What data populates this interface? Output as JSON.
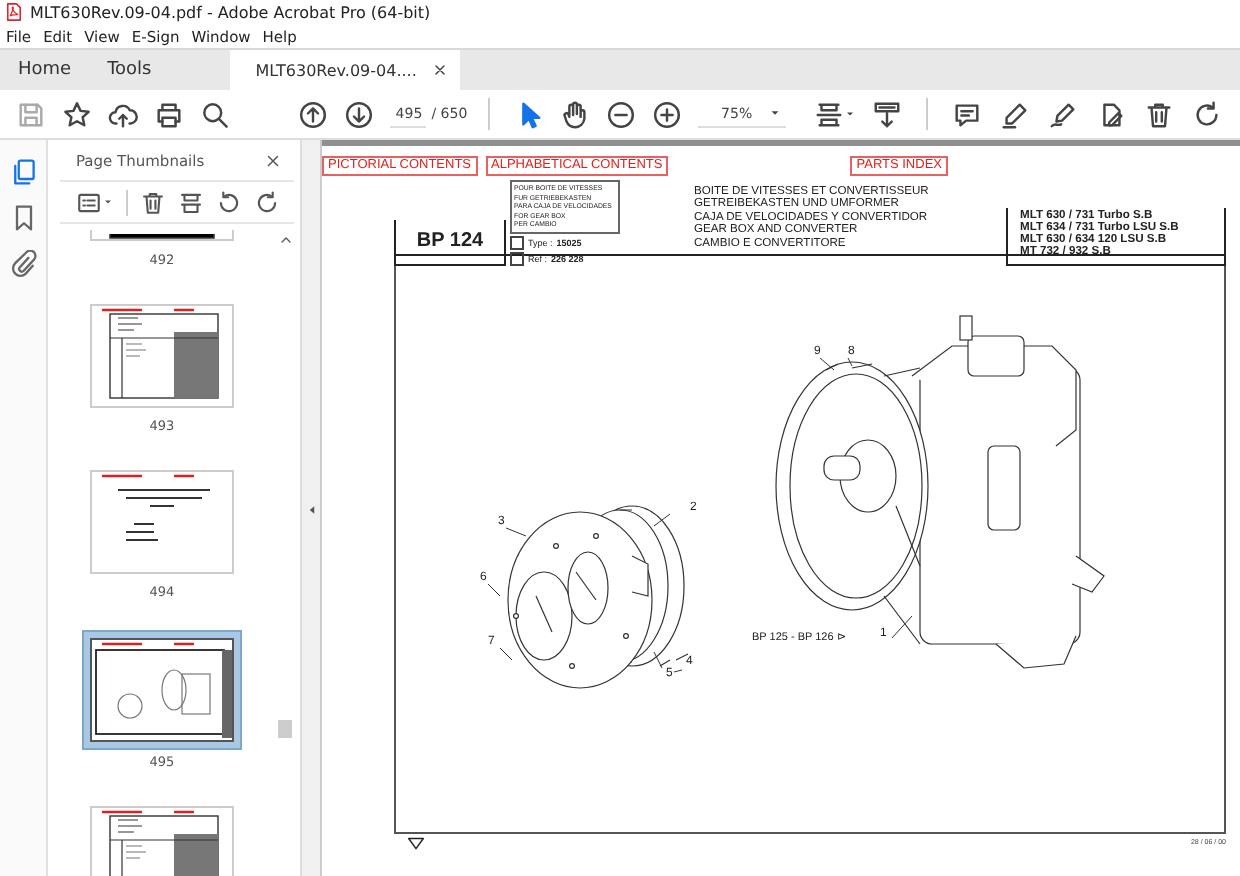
{
  "window": {
    "title": "MLT630Rev.09-04.pdf - Adobe Acrobat Pro (64-bit)"
  },
  "menu": [
    "File",
    "Edit",
    "View",
    "E-Sign",
    "Window",
    "Help"
  ],
  "tabs": [
    {
      "label": "Home",
      "selected": false
    },
    {
      "label": "Tools",
      "selected": false
    },
    {
      "label": "MLT630Rev.09-04....",
      "selected": true
    }
  ],
  "toolbar": {
    "save_disabled": true,
    "page": "495",
    "page_total": "/ 650",
    "zoom": "75%",
    "pointer_tools": [
      {
        "kind": "select",
        "selected": true
      },
      {
        "kind": "hand",
        "selected": false
      }
    ]
  },
  "sidebar": {
    "rail": [
      {
        "kind": "pages",
        "selected": true
      },
      {
        "kind": "bookmarks",
        "selected": false
      },
      {
        "kind": "attachments",
        "selected": false
      }
    ],
    "panel_title": "Page Thumbnails",
    "thumbnails": [
      {
        "label": "492",
        "kind": "cut",
        "selected": false
      },
      {
        "label": "493",
        "kind": "table",
        "selected": false
      },
      {
        "label": "494",
        "kind": "title",
        "selected": false
      },
      {
        "label": "495",
        "kind": "drawing",
        "selected": true
      },
      {
        "kind": "table",
        "selected": false
      }
    ]
  },
  "document": {
    "links": [
      "PICTORIAL CONTENTS",
      "ALPHABETICAL CONTENTS",
      "PARTS INDEX"
    ],
    "code": "BP 124",
    "for_lines": [
      "POUR BOITE DE VITESSES",
      "FUR GETRIEBEKASTEN",
      "PARA CAJA DE VELOCIDADES",
      "FOR GEAR BOX",
      "PER CAMBIO"
    ],
    "type_label": "Type :",
    "type_value": "15025",
    "ref_label": "Ref :",
    "ref_value": "226 228",
    "titles": [
      "BOITE DE VITESSES ET CONVERTISSEUR",
      "GETREIBEKASTEN UND UMFORMER",
      "CAJA DE VELOCIDADES Y CONVERTIDOR",
      "GEAR BOX AND CONVERTER",
      "CAMBIO E CONVERTITORE"
    ],
    "models": [
      "MLT 630 / 731 Turbo S.B",
      "MLT 634 / 731 Turbo LSU S.B",
      "MLT 630 / 634 120 LSU S.B",
      "MT 732 / 932 S.B"
    ],
    "callouts": [
      "1",
      "2",
      "3",
      "4",
      "5",
      "6",
      "7",
      "8",
      "9"
    ],
    "cross_ref": "BP 125 - BP 126 ⊳",
    "date": "28 / 06 / 00"
  }
}
